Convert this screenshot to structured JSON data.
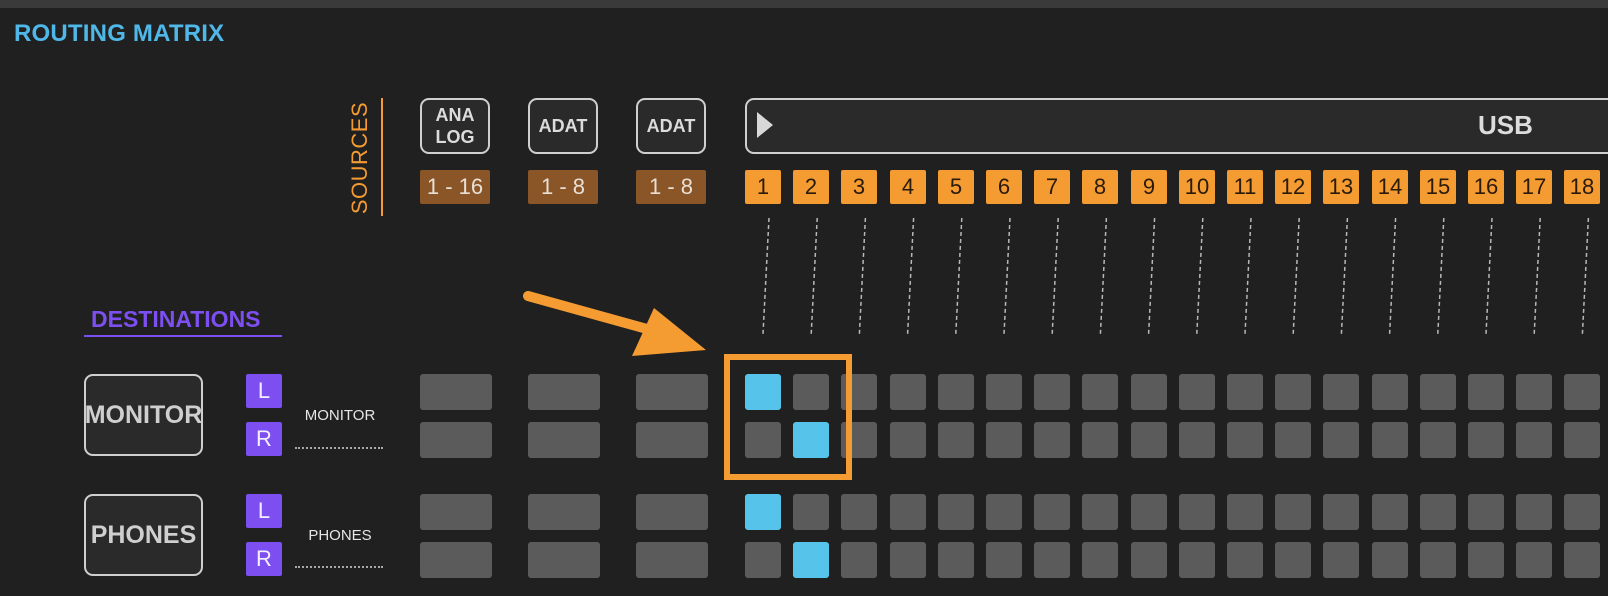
{
  "title": "ROUTING MATRIX",
  "sources": {
    "label": "SOURCES",
    "groups": [
      {
        "name": "ANA\nLOG",
        "range": "1 - 16"
      },
      {
        "name": "ADAT",
        "range": "1 - 8"
      },
      {
        "name": "ADAT",
        "range": "1 - 8"
      }
    ],
    "usb": {
      "label": "USB",
      "channels": [
        "1",
        "2",
        "3",
        "4",
        "5",
        "6",
        "7",
        "8",
        "9",
        "10",
        "11",
        "12",
        "13",
        "14",
        "15",
        "16",
        "17",
        "18"
      ]
    }
  },
  "destinations": {
    "label": "DESTINATIONS",
    "groups": [
      {
        "name": "MONITOR",
        "sublabel": "MONITOR",
        "rows": [
          {
            "side": "L",
            "active_usb": [
              "1"
            ]
          },
          {
            "side": "R",
            "active_usb": [
              "2"
            ]
          }
        ]
      },
      {
        "name": "PHONES",
        "sublabel": "PHONES",
        "rows": [
          {
            "side": "L",
            "active_usb": [
              "1"
            ]
          },
          {
            "side": "R",
            "active_usb": [
              "2"
            ]
          }
        ]
      }
    ]
  },
  "colors": {
    "title": "#4fb8e8",
    "source_accent": "#f49b32",
    "range_tag": "#8a5628",
    "destination_accent": "#7d4ff0",
    "cell_off": "#5b5b5b",
    "cell_on": "#56c4ea",
    "highlight": "#f49b32"
  },
  "icons": {
    "usb_expand": "play-triangle-icon",
    "annotation": "arrow-pointer-icon"
  }
}
